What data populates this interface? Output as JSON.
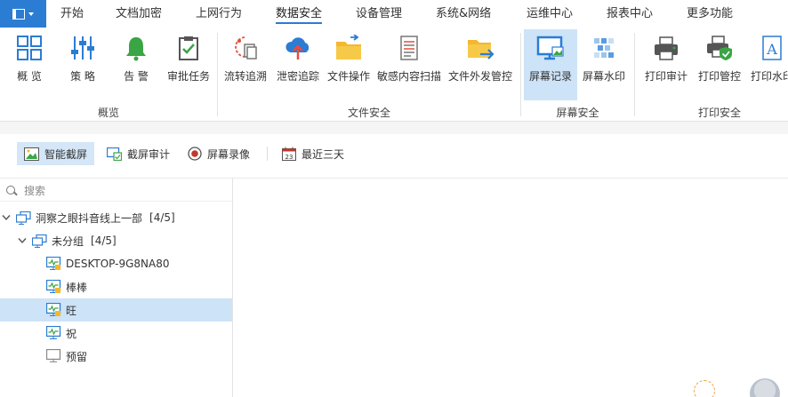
{
  "menubar": {
    "tabs": [
      {
        "label": "开始"
      },
      {
        "label": "文档加密"
      },
      {
        "label": "上网行为"
      },
      {
        "label": "数据安全"
      },
      {
        "label": "设备管理"
      },
      {
        "label": "系统&网络"
      },
      {
        "label": "运维中心"
      },
      {
        "label": "报表中心"
      },
      {
        "label": "更多功能"
      }
    ],
    "active_tab": "数据安全"
  },
  "ribbon": {
    "buttons": [
      {
        "label": "概 览",
        "icon": "grid-icon"
      },
      {
        "label": "策 略",
        "icon": "sliders-icon"
      },
      {
        "label": "告 警",
        "icon": "bell-icon"
      },
      {
        "label": "审批任务",
        "icon": "clipboard-check-icon"
      },
      {
        "label": "流转追溯",
        "icon": "trace-icon"
      },
      {
        "label": "泄密追踪",
        "icon": "cloud-upload-icon"
      },
      {
        "label": "文件操作",
        "icon": "folder-icon"
      },
      {
        "label": "敏感内容扫描",
        "icon": "document-scan-icon"
      },
      {
        "label": "文件外发管控",
        "icon": "folder-send-icon"
      },
      {
        "label": "屏幕记录",
        "icon": "monitor-image-icon"
      },
      {
        "label": "屏幕水印",
        "icon": "watermark-icon"
      },
      {
        "label": "打印审计",
        "icon": "printer-icon"
      },
      {
        "label": "打印管控",
        "icon": "printer-shield-icon"
      },
      {
        "label": "打印水印",
        "icon": "text-a-icon"
      }
    ],
    "groups": [
      {
        "label": "概览"
      },
      {
        "label": "文件安全"
      },
      {
        "label": "屏幕安全"
      },
      {
        "label": "打印安全"
      }
    ]
  },
  "toolbar": {
    "items": [
      {
        "label": "智能截屏",
        "icon": "image-icon"
      },
      {
        "label": "截屏审计",
        "icon": "screen-audit-icon"
      },
      {
        "label": "屏幕录像",
        "icon": "record-icon"
      },
      {
        "label": "最近三天",
        "icon": "calendar-icon"
      }
    ],
    "calendar_day": "23"
  },
  "tree": {
    "search_placeholder": "搜索",
    "nodes": [
      {
        "label": "洞察之眼抖音线上一部",
        "count": "[4/5]"
      },
      {
        "label": "未分组",
        "count": "[4/5]"
      },
      {
        "label": "DESKTOP-9G8NA80"
      },
      {
        "label": "棒棒"
      },
      {
        "label": "旺"
      },
      {
        "label": "祝"
      },
      {
        "label": "预留"
      }
    ]
  },
  "colors": {
    "accent": "#2b7cd3",
    "selected_bg": "#cde3f7"
  }
}
